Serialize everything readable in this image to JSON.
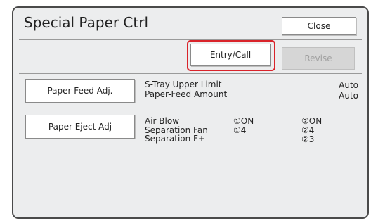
{
  "title": "Special Paper Ctrl",
  "buttons": {
    "close": "Close",
    "entry_call": "Entry/Call",
    "revise": "Revise",
    "paper_feed_adj": "Paper Feed Adj.",
    "paper_eject_adj": "Paper Eject Adj"
  },
  "feed_settings": {
    "label1": "S-Tray Upper Limit",
    "label2": "Paper-Feed Amount",
    "value1": "Auto",
    "value2": "Auto"
  },
  "eject_settings": {
    "labels": [
      "Air Blow",
      "Separation Fan",
      "Separation F+"
    ],
    "col1": [
      "①ON",
      "①4"
    ],
    "col2": [
      "②ON",
      "②4",
      "②3"
    ]
  }
}
